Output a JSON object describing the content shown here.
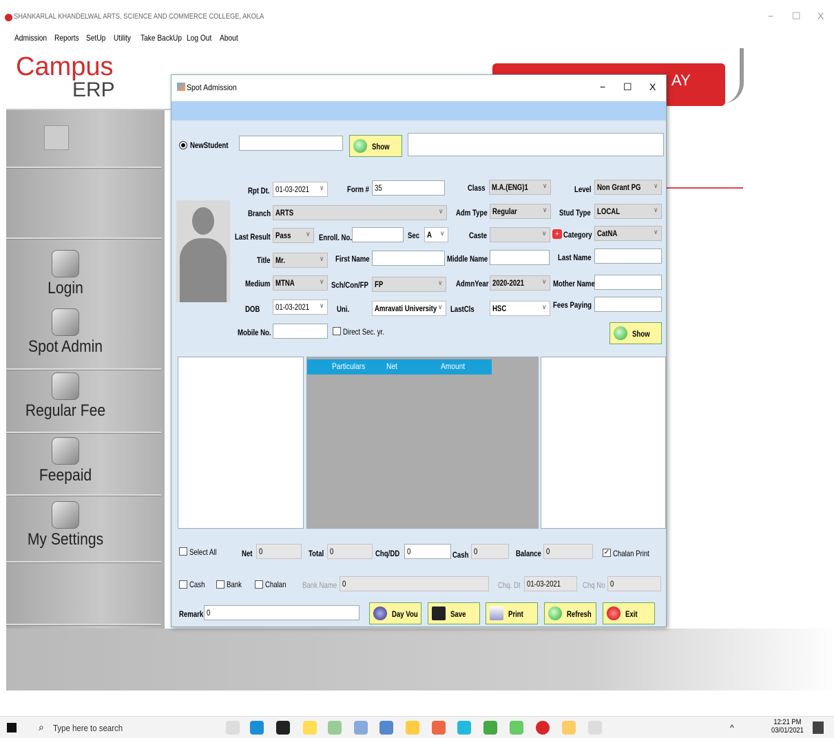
{
  "window": {
    "title": "SHANKARLAL KHANDELWAL ARTS, SCIENCE AND COMMERCE COLLEGE, AKOLA",
    "min": "−",
    "max": "☐",
    "close": "X"
  },
  "menu": [
    "Admission",
    "Reports",
    "SetUp",
    "Utility",
    "Take BackUp",
    "Log Out",
    "About"
  ],
  "logo": {
    "line1": "Campus",
    "line2": "ERP"
  },
  "banner_text": "AY",
  "sidebar": [
    {
      "label": "Login",
      "icon": "key-icon"
    },
    {
      "label": "Spot Admin",
      "icon": "user-card-icon"
    },
    {
      "label": "Regular Fee",
      "icon": "receipt-icon"
    },
    {
      "label": "Feepaid",
      "icon": "users-icon"
    },
    {
      "label": "My Settings",
      "icon": "tools-icon"
    }
  ],
  "dialog": {
    "title": "Spot Admission",
    "min": "−",
    "max": "☐",
    "close": "X",
    "new_student": "NewStudent",
    "show": "Show",
    "rpt_dt_label": "Rpt Dt.",
    "rpt_dt": "01-03-2021",
    "form_label": "Form #",
    "form": "35",
    "class_label": "Class",
    "class": "M.A.(ENG)1",
    "level_label": "Level",
    "level": "Non Grant PG",
    "branch_label": "Branch",
    "branch": "ARTS",
    "adm_type_label": "Adm Type",
    "adm_type": "Regular",
    "stud_type_label": "Stud Type",
    "stud_type": "LOCAL",
    "last_result_label": "Last Result",
    "last_result": "Pass",
    "enroll_label": "Enroll. No.",
    "enroll": "",
    "sec_label": "Sec",
    "sec": "A",
    "caste_label": "Caste",
    "caste": "",
    "category_label": "Category",
    "category": "CatNA",
    "title_label": "Title",
    "title_val": "Mr.",
    "first_name_label": "First Name",
    "first_name": "",
    "middle_name_label": "Middle Name",
    "middle_name": "",
    "last_name_label": "Last Name",
    "last_name": "",
    "medium_label": "Medium",
    "medium": "MTNA",
    "sch_label": "Sch/Con/FP",
    "sch": "FP",
    "admn_year_label": "AdmnYear",
    "admn_year": "2020-2021",
    "mother_label": "Mother Name",
    "mother": "",
    "dob_label": "DOB",
    "dob": "01-03-2021",
    "uni_label": "Uni.",
    "uni": "Amravati University",
    "lastcls_label": "LastCls",
    "lastcls": "HSC",
    "fees_paying_label": "Fees Paying",
    "fees_paying": "",
    "mobile_label": "Mobile No.",
    "mobile": "",
    "direct_sec": "Direct Sec. yr.",
    "grid_headers": [
      "Particulars",
      "Net",
      "Amount"
    ],
    "select_all": "Select All",
    "net_label": "Net",
    "net": "0",
    "total_label": "Total",
    "total": "0",
    "chqdd_label": "Chq/DD",
    "chqdd": "0",
    "cash_label": "Cash",
    "cash": "0",
    "balance_label": "Balance",
    "balance": "0",
    "chalan_print": "Chalan Print",
    "cash_chk": "Cash",
    "bank_chk": "Bank",
    "chalan_chk": "Chalan",
    "bank_name_label": "Bank Name",
    "bank_name": "0",
    "chq_dt_label": "Chq. Dt",
    "chq_dt": "01-03-2021",
    "chq_no_label": "Chq No",
    "chq_no": "0",
    "remark_label": "Remark",
    "remark": "0",
    "buttons": [
      "Day Vou",
      "Save",
      "Print",
      "Refresh",
      "Exit"
    ]
  },
  "taskbar": {
    "search": "Type here to search",
    "time": "12:21 PM",
    "date": "03/01/2021"
  }
}
